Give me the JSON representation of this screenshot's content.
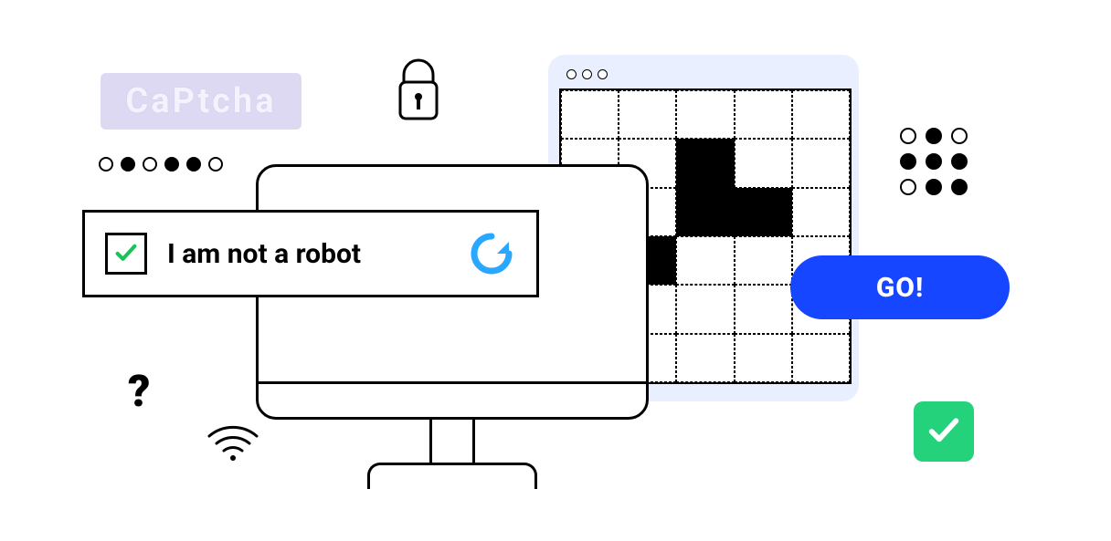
{
  "captcha_tag": {
    "text": "CaPtcha"
  },
  "nar_panel": {
    "label": "I am not a robot"
  },
  "go_button": {
    "label": "GO!"
  },
  "icons": {
    "lock": "lock-icon",
    "refresh": "refresh-icon",
    "wifi": "wifi-icon",
    "question": "?",
    "check": "check-icon"
  },
  "colors": {
    "captcha_bg": "#ddd9f2",
    "go_button": "#1646ff",
    "green_check": "#23d27a",
    "refresh": "#2aa8ff",
    "picker_bg": "#e9efff"
  },
  "dot_row_left": [
    "open",
    "full",
    "open",
    "full",
    "full",
    "open"
  ],
  "dot_grid_right": [
    "open",
    "full",
    "open",
    "full",
    "full",
    "full",
    "open",
    "full",
    "full"
  ],
  "picker_grid": {
    "cols": 5,
    "rows": 6,
    "filled_cells": [
      7,
      12,
      13,
      16
    ]
  }
}
